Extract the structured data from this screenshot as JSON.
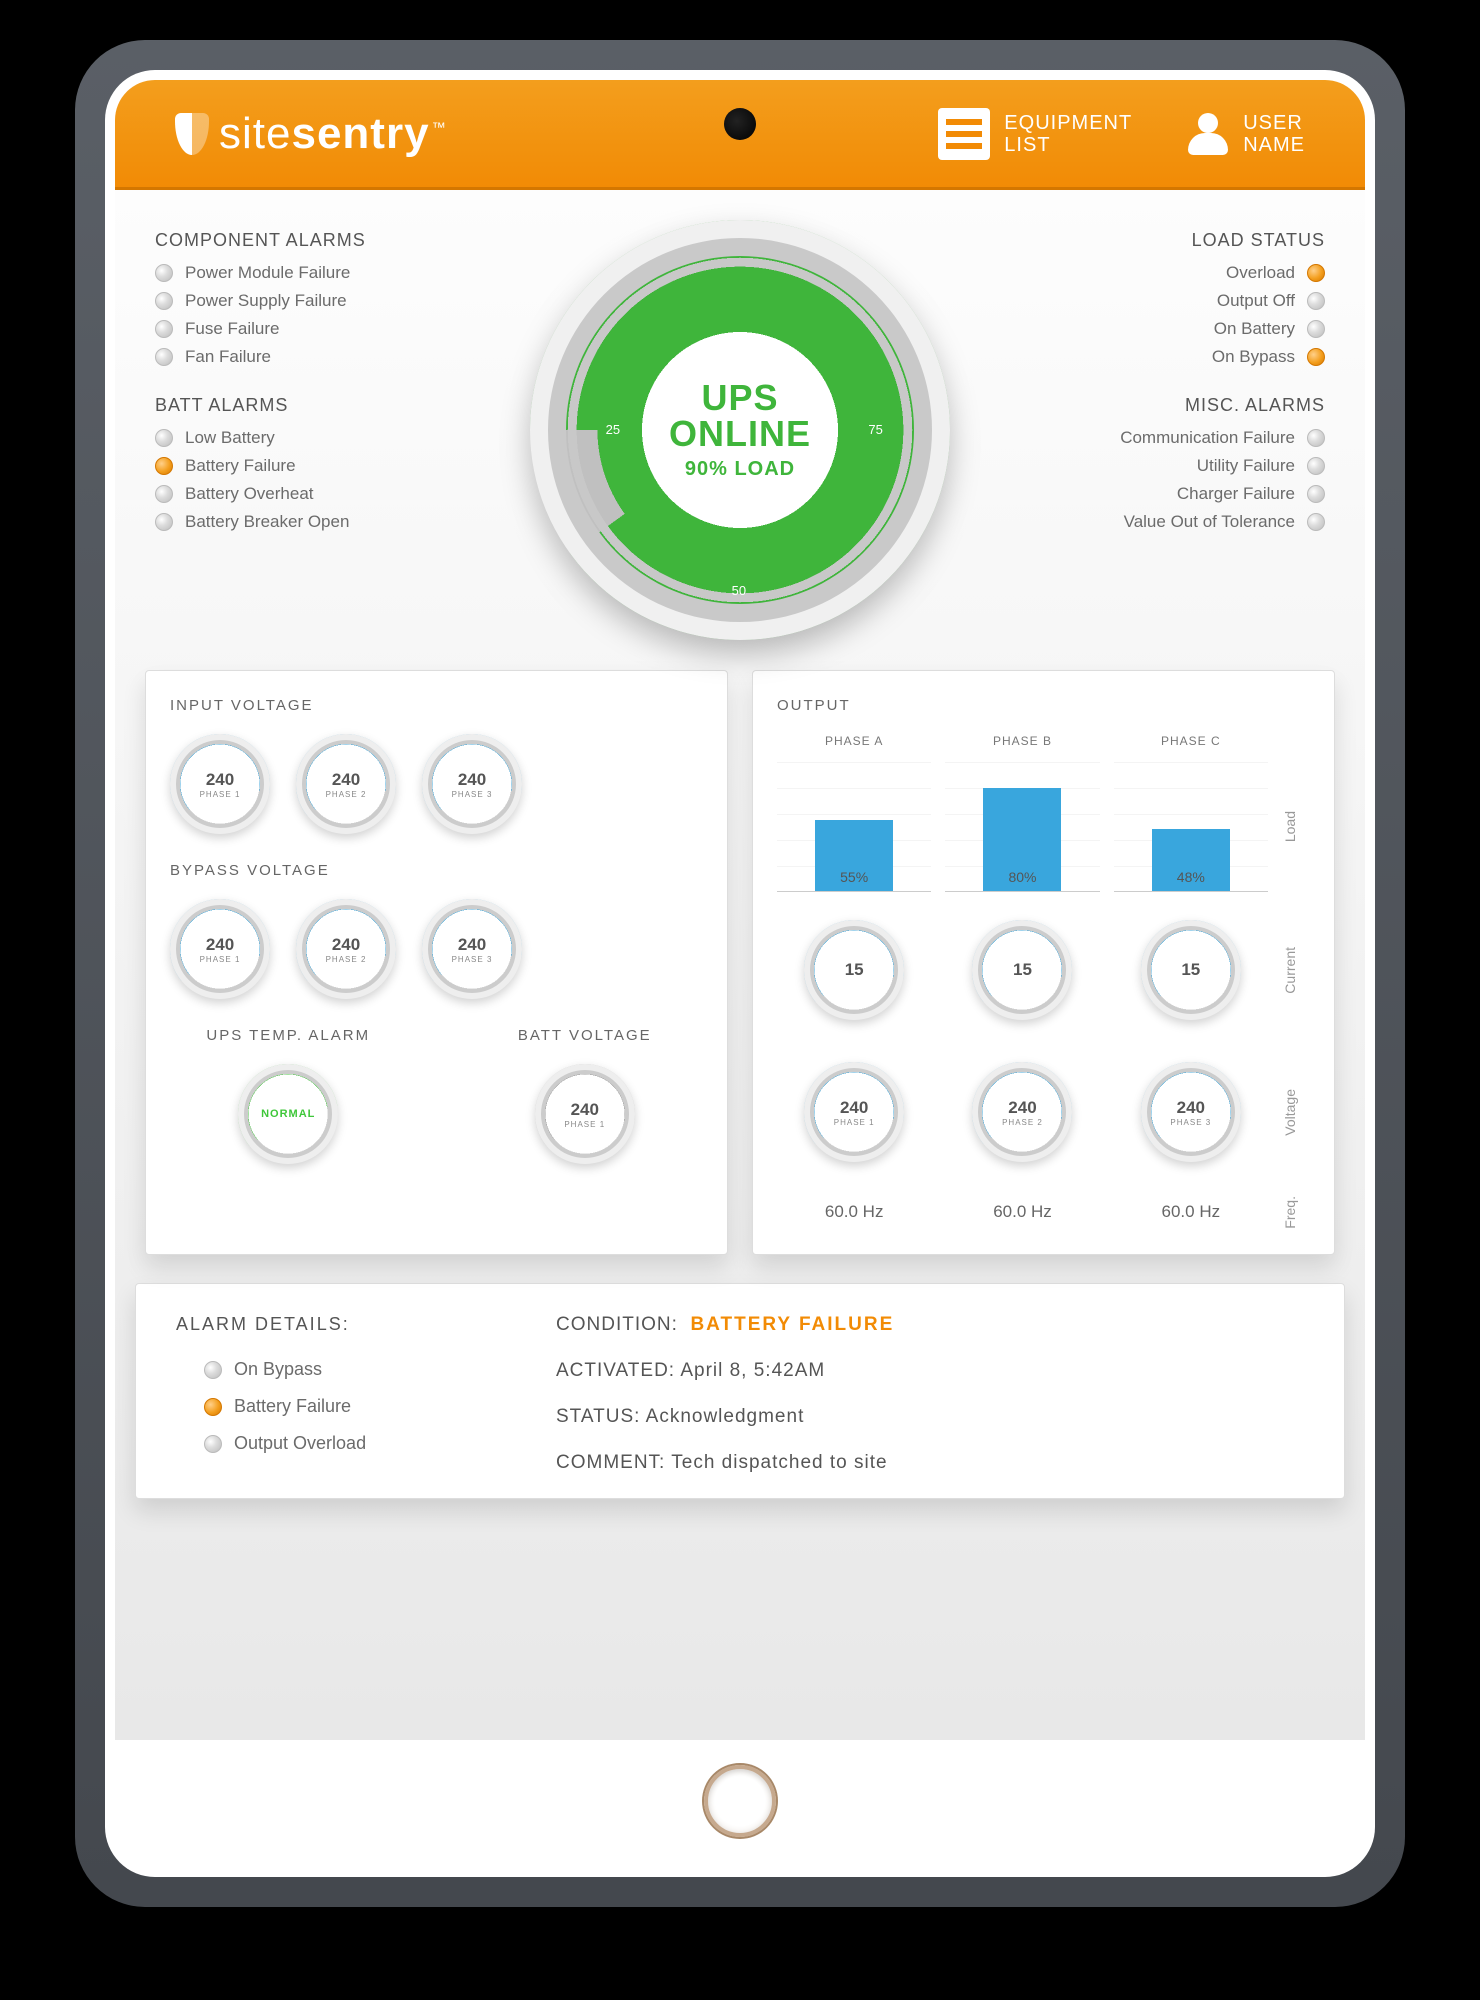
{
  "header": {
    "brand_a": "site",
    "brand_b": "sentry",
    "tm": "™",
    "equipment_list": "EQUIPMENT\nLIST",
    "user_name": "USER\nNAME"
  },
  "component_alarms": {
    "title": "COMPONENT ALARMS",
    "items": [
      {
        "label": "Power Module Failure",
        "on": false
      },
      {
        "label": "Power Supply Failure",
        "on": false
      },
      {
        "label": "Fuse Failure",
        "on": false
      },
      {
        "label": "Fan Failure",
        "on": false
      }
    ]
  },
  "batt_alarms": {
    "title": "BATT ALARMS",
    "items": [
      {
        "label": "Low Battery",
        "on": false
      },
      {
        "label": "Battery Failure",
        "on": true
      },
      {
        "label": "Battery Overheat",
        "on": false
      },
      {
        "label": "Battery Breaker Open",
        "on": false
      }
    ]
  },
  "load_status": {
    "title": "LOAD STATUS",
    "items": [
      {
        "label": "Overload",
        "on": true
      },
      {
        "label": "Output Off",
        "on": false
      },
      {
        "label": "On Battery",
        "on": false
      },
      {
        "label": "On Bypass",
        "on": true
      }
    ]
  },
  "misc_alarms": {
    "title": "MISC. ALARMS",
    "items": [
      {
        "label": "Communication Failure",
        "on": false
      },
      {
        "label": "Utility Failure",
        "on": false
      },
      {
        "label": "Charger Failure",
        "on": false
      },
      {
        "label": "Value Out of Tolerance",
        "on": false
      }
    ]
  },
  "main_gauge": {
    "line1": "UPS",
    "line2": "ONLINE",
    "load_label": "90% LOAD",
    "ticks": {
      "t25": "25",
      "t50": "50",
      "t75": "75"
    }
  },
  "input_voltage": {
    "title": "INPUT VOLTAGE",
    "phases": [
      {
        "value": "240",
        "label": "PHASE 1"
      },
      {
        "value": "240",
        "label": "PHASE 2"
      },
      {
        "value": "240",
        "label": "PHASE 3"
      }
    ]
  },
  "bypass_voltage": {
    "title": "BYPASS VOLTAGE",
    "phases": [
      {
        "value": "240",
        "label": "PHASE 1"
      },
      {
        "value": "240",
        "label": "PHASE 2"
      },
      {
        "value": "240",
        "label": "PHASE 3"
      }
    ]
  },
  "ups_temp": {
    "title": "UPS TEMP. ALARM",
    "value": "NORMAL"
  },
  "batt_voltage": {
    "title": "BATT VOLTAGE",
    "value": "240",
    "label": "PHASE 1"
  },
  "output": {
    "title": "OUTPUT",
    "phase_labels": [
      "PHASE A",
      "PHASE B",
      "PHASE C"
    ],
    "row_labels": {
      "load": "Load",
      "current": "Current",
      "voltage": "Voltage",
      "freq": "Freq."
    },
    "load_pct": [
      "55%",
      "80%",
      "48%"
    ],
    "current": [
      {
        "value": "15"
      },
      {
        "value": "15"
      },
      {
        "value": "15"
      }
    ],
    "voltage": [
      {
        "value": "240",
        "label": "PHASE 1"
      },
      {
        "value": "240",
        "label": "PHASE 2"
      },
      {
        "value": "240",
        "label": "PHASE 3"
      }
    ],
    "freq": [
      "60.0 Hz",
      "60.0 Hz",
      "60.0 Hz"
    ]
  },
  "alarm_details": {
    "title": "ALARM DETAILS:",
    "items": [
      {
        "label": "On Bypass",
        "on": false
      },
      {
        "label": "Battery Failure",
        "on": true
      },
      {
        "label": "Output Overload",
        "on": false
      }
    ],
    "condition_key": "CONDITION:",
    "condition_val": "BATTERY FAILURE",
    "activated_key": "ACTIVATED:",
    "activated_val": "April 8, 5:42AM",
    "status_key": "STATUS:",
    "status_val": "Acknowledgment",
    "comment_key": "COMMENT:",
    "comment_val": "Tech dispatched to site"
  },
  "chart_data": {
    "type": "bar",
    "title": "Output Load",
    "categories": [
      "PHASE A",
      "PHASE B",
      "PHASE C"
    ],
    "values": [
      55,
      80,
      48
    ],
    "ylabel": "Load %",
    "ylim": [
      0,
      100
    ]
  }
}
